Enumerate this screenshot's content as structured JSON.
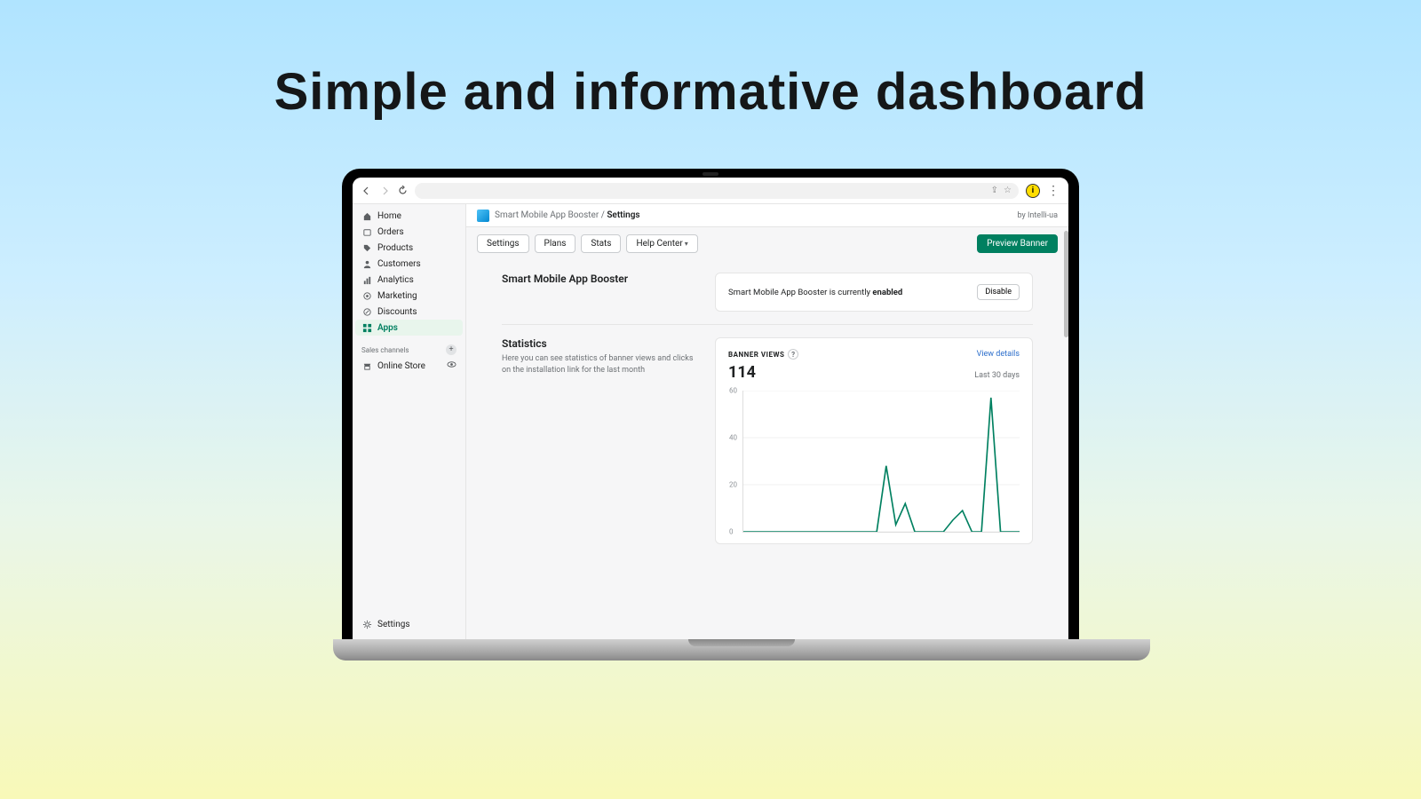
{
  "hero": {
    "title": "Simple and informative dashboard"
  },
  "breadcrumb": {
    "app": "Smart Mobile App Booster",
    "sep": " / ",
    "page": "Settings",
    "vendor": "by Intelli-ua"
  },
  "toolbar": {
    "settings": "Settings",
    "plans": "Plans",
    "stats": "Stats",
    "help": "Help Center",
    "preview": "Preview Banner"
  },
  "sidebar": {
    "items": [
      {
        "label": "Home"
      },
      {
        "label": "Orders"
      },
      {
        "label": "Products"
      },
      {
        "label": "Customers"
      },
      {
        "label": "Analytics"
      },
      {
        "label": "Marketing"
      },
      {
        "label": "Discounts"
      },
      {
        "label": "Apps"
      }
    ],
    "channels_label": "Sales channels",
    "channels": [
      {
        "label": "Online Store"
      }
    ],
    "settings": "Settings"
  },
  "section1": {
    "title": "Smart Mobile App Booster",
    "status_prefix": "Smart Mobile App Booster is currently ",
    "status_state": "enabled",
    "disable": "Disable"
  },
  "section2": {
    "title": "Statistics",
    "desc": "Here you can see statistics of banner views and clicks on the installation link for the last month",
    "metric_label": "BANNER VIEWS",
    "view_details": "View details",
    "value": "114",
    "range": "Last 30 days"
  },
  "chart_data": {
    "type": "line",
    "title": "Banner Views",
    "ylabel": "",
    "xlabel": "",
    "ylim": [
      0,
      60
    ],
    "yticks": [
      0,
      20,
      40,
      60
    ],
    "x": [
      1,
      2,
      3,
      4,
      5,
      6,
      7,
      8,
      9,
      10,
      11,
      12,
      13,
      14,
      15,
      16,
      17,
      18,
      19,
      20,
      21,
      22,
      23,
      24,
      25,
      26,
      27,
      28,
      29,
      30
    ],
    "values": [
      0,
      0,
      0,
      0,
      0,
      0,
      0,
      0,
      0,
      0,
      0,
      0,
      0,
      0,
      0,
      28,
      3,
      12,
      0,
      0,
      0,
      0,
      5,
      9,
      0,
      0,
      57,
      0,
      0,
      0
    ]
  }
}
